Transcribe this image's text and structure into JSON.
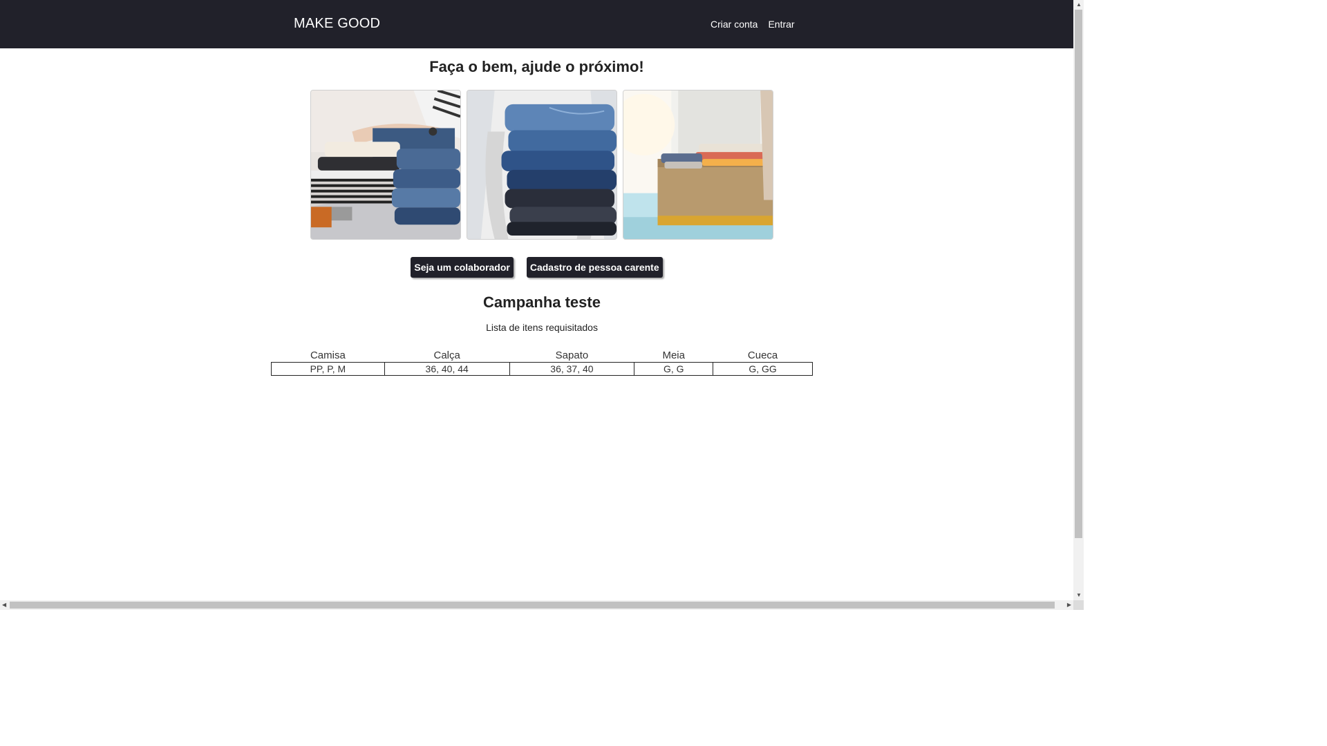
{
  "navbar": {
    "brand": "MAKE GOOD",
    "links": [
      {
        "label": "Criar conta"
      },
      {
        "label": "Entrar"
      }
    ]
  },
  "hero": {
    "headline": "Faça o bem, ajude o próximo!",
    "images": [
      {
        "icon": "photo-folding-clothes"
      },
      {
        "icon": "photo-stack-of-jeans"
      },
      {
        "icon": "photo-donation-box"
      }
    ]
  },
  "actions": {
    "collaborator_label": "Seja um colaborador",
    "register_needy_label": "Cadastro de pessoa carente"
  },
  "campaign": {
    "title": "Campanha teste",
    "subtitle": "Lista de itens requisitados",
    "columns": [
      "Camisa",
      "Calça",
      "Sapato",
      "Meia",
      "Cueca"
    ],
    "rows": [
      [
        "PP, P, M",
        "36, 40, 44",
        "36, 37, 40",
        "G, G",
        "G, GG"
      ]
    ]
  },
  "colors": {
    "navbar_bg": "#21212a",
    "button_bg": "#21212a",
    "text": "#222222"
  }
}
